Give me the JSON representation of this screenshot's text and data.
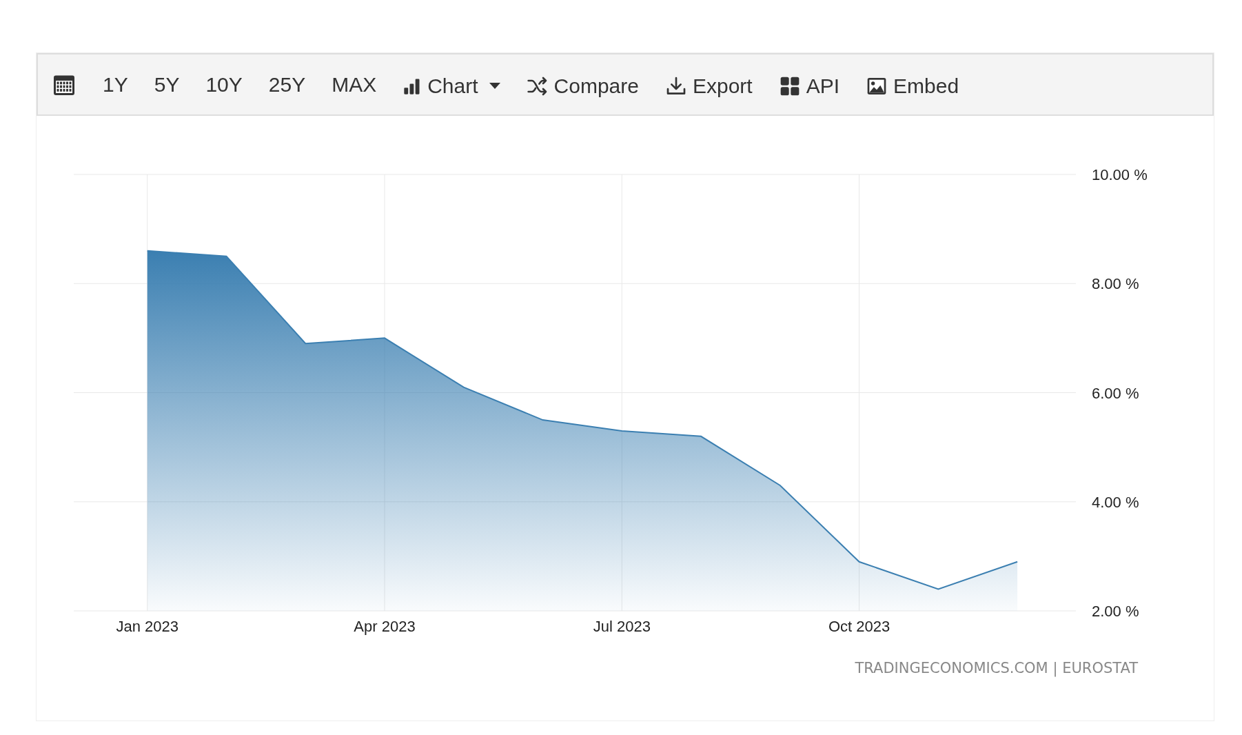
{
  "toolbar": {
    "ranges": [
      "1Y",
      "5Y",
      "10Y",
      "25Y",
      "MAX"
    ],
    "buttons": [
      {
        "kind": "chart",
        "label": "Chart"
      },
      {
        "kind": "compare",
        "label": "Compare"
      },
      {
        "kind": "export",
        "label": "Export"
      },
      {
        "kind": "api",
        "label": "API"
      },
      {
        "kind": "embed",
        "label": "Embed"
      }
    ]
  },
  "chart": {
    "chart_data": {
      "type": "area",
      "categories": [
        "Jan 2023",
        null,
        null,
        "Apr 2023",
        null,
        null,
        "Jul 2023",
        null,
        null,
        "Oct 2023",
        null,
        null
      ],
      "series": [
        {
          "color": "#3b7fb1",
          "values": [
            8.6,
            8.5,
            6.9,
            7.0,
            6.1,
            5.5,
            5.3,
            5.2,
            4.3,
            2.9,
            2.4,
            2.9
          ]
        }
      ],
      "ylim": [
        2,
        10
      ],
      "grid": true,
      "yticks": [
        {
          "value": 2,
          "label": "2.00 %"
        },
        {
          "value": 4,
          "label": "4.00 %"
        },
        {
          "value": 6,
          "label": "6.00 %"
        },
        {
          "value": 8,
          "label": "8.00 %"
        },
        {
          "value": 10,
          "label": "10.00 %"
        }
      ]
    },
    "source": "TRADINGECONOMICS.COM | EUROSTAT"
  }
}
